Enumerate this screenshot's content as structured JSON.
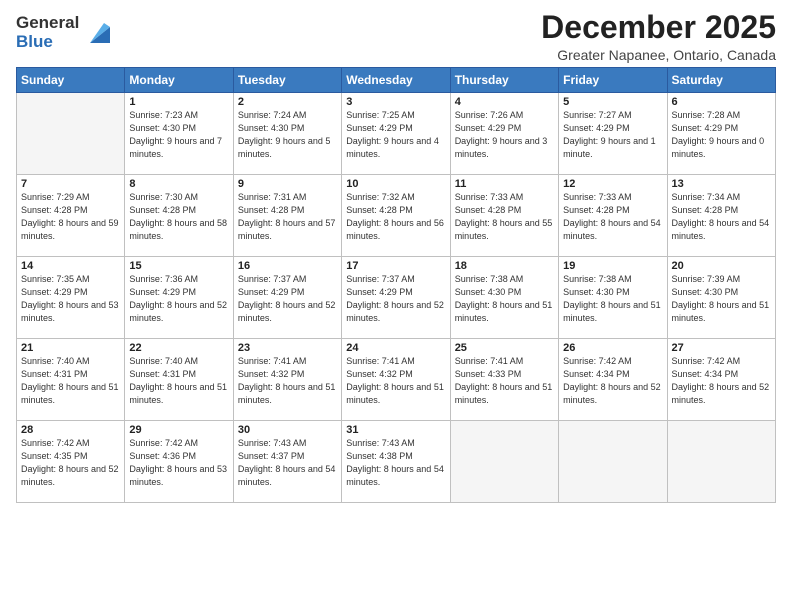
{
  "header": {
    "logo_line1": "General",
    "logo_line2": "Blue",
    "month_title": "December 2025",
    "location": "Greater Napanee, Ontario, Canada"
  },
  "weekdays": [
    "Sunday",
    "Monday",
    "Tuesday",
    "Wednesday",
    "Thursday",
    "Friday",
    "Saturday"
  ],
  "weeks": [
    [
      {
        "day": "",
        "empty": true
      },
      {
        "day": "1",
        "sunrise": "7:23 AM",
        "sunset": "4:30 PM",
        "daylight": "9 hours and 7 minutes."
      },
      {
        "day": "2",
        "sunrise": "7:24 AM",
        "sunset": "4:30 PM",
        "daylight": "9 hours and 5 minutes."
      },
      {
        "day": "3",
        "sunrise": "7:25 AM",
        "sunset": "4:29 PM",
        "daylight": "9 hours and 4 minutes."
      },
      {
        "day": "4",
        "sunrise": "7:26 AM",
        "sunset": "4:29 PM",
        "daylight": "9 hours and 3 minutes."
      },
      {
        "day": "5",
        "sunrise": "7:27 AM",
        "sunset": "4:29 PM",
        "daylight": "9 hours and 1 minute."
      },
      {
        "day": "6",
        "sunrise": "7:28 AM",
        "sunset": "4:29 PM",
        "daylight": "9 hours and 0 minutes."
      }
    ],
    [
      {
        "day": "7",
        "sunrise": "7:29 AM",
        "sunset": "4:28 PM",
        "daylight": "8 hours and 59 minutes."
      },
      {
        "day": "8",
        "sunrise": "7:30 AM",
        "sunset": "4:28 PM",
        "daylight": "8 hours and 58 minutes."
      },
      {
        "day": "9",
        "sunrise": "7:31 AM",
        "sunset": "4:28 PM",
        "daylight": "8 hours and 57 minutes."
      },
      {
        "day": "10",
        "sunrise": "7:32 AM",
        "sunset": "4:28 PM",
        "daylight": "8 hours and 56 minutes."
      },
      {
        "day": "11",
        "sunrise": "7:33 AM",
        "sunset": "4:28 PM",
        "daylight": "8 hours and 55 minutes."
      },
      {
        "day": "12",
        "sunrise": "7:33 AM",
        "sunset": "4:28 PM",
        "daylight": "8 hours and 54 minutes."
      },
      {
        "day": "13",
        "sunrise": "7:34 AM",
        "sunset": "4:28 PM",
        "daylight": "8 hours and 54 minutes."
      }
    ],
    [
      {
        "day": "14",
        "sunrise": "7:35 AM",
        "sunset": "4:29 PM",
        "daylight": "8 hours and 53 minutes."
      },
      {
        "day": "15",
        "sunrise": "7:36 AM",
        "sunset": "4:29 PM",
        "daylight": "8 hours and 52 minutes."
      },
      {
        "day": "16",
        "sunrise": "7:37 AM",
        "sunset": "4:29 PM",
        "daylight": "8 hours and 52 minutes."
      },
      {
        "day": "17",
        "sunrise": "7:37 AM",
        "sunset": "4:29 PM",
        "daylight": "8 hours and 52 minutes."
      },
      {
        "day": "18",
        "sunrise": "7:38 AM",
        "sunset": "4:30 PM",
        "daylight": "8 hours and 51 minutes."
      },
      {
        "day": "19",
        "sunrise": "7:38 AM",
        "sunset": "4:30 PM",
        "daylight": "8 hours and 51 minutes."
      },
      {
        "day": "20",
        "sunrise": "7:39 AM",
        "sunset": "4:30 PM",
        "daylight": "8 hours and 51 minutes."
      }
    ],
    [
      {
        "day": "21",
        "sunrise": "7:40 AM",
        "sunset": "4:31 PM",
        "daylight": "8 hours and 51 minutes."
      },
      {
        "day": "22",
        "sunrise": "7:40 AM",
        "sunset": "4:31 PM",
        "daylight": "8 hours and 51 minutes."
      },
      {
        "day": "23",
        "sunrise": "7:41 AM",
        "sunset": "4:32 PM",
        "daylight": "8 hours and 51 minutes."
      },
      {
        "day": "24",
        "sunrise": "7:41 AM",
        "sunset": "4:32 PM",
        "daylight": "8 hours and 51 minutes."
      },
      {
        "day": "25",
        "sunrise": "7:41 AM",
        "sunset": "4:33 PM",
        "daylight": "8 hours and 51 minutes."
      },
      {
        "day": "26",
        "sunrise": "7:42 AM",
        "sunset": "4:34 PM",
        "daylight": "8 hours and 52 minutes."
      },
      {
        "day": "27",
        "sunrise": "7:42 AM",
        "sunset": "4:34 PM",
        "daylight": "8 hours and 52 minutes."
      }
    ],
    [
      {
        "day": "28",
        "sunrise": "7:42 AM",
        "sunset": "4:35 PM",
        "daylight": "8 hours and 52 minutes."
      },
      {
        "day": "29",
        "sunrise": "7:42 AM",
        "sunset": "4:36 PM",
        "daylight": "8 hours and 53 minutes."
      },
      {
        "day": "30",
        "sunrise": "7:43 AM",
        "sunset": "4:37 PM",
        "daylight": "8 hours and 54 minutes."
      },
      {
        "day": "31",
        "sunrise": "7:43 AM",
        "sunset": "4:38 PM",
        "daylight": "8 hours and 54 minutes."
      },
      {
        "day": "",
        "empty": true
      },
      {
        "day": "",
        "empty": true
      },
      {
        "day": "",
        "empty": true
      }
    ]
  ]
}
